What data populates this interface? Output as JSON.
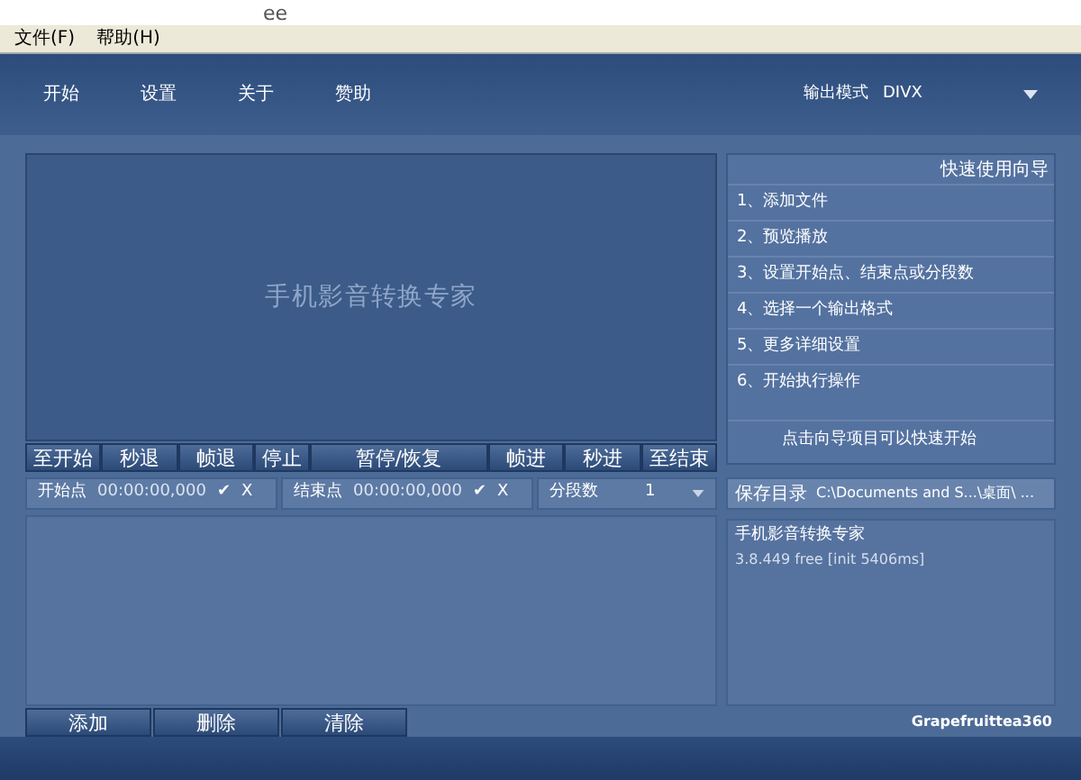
{
  "window": {
    "title": "ee"
  },
  "menu": [
    "文件(F)",
    "帮助(H)"
  ],
  "nav": [
    "开始",
    "设置",
    "关于",
    "赞助"
  ],
  "output_mode": {
    "label": "输出模式",
    "value": "DIVX"
  },
  "preview": {
    "title": "手机影音转换专家"
  },
  "playback_buttons": [
    "至开始",
    "秒退",
    "帧退",
    "停止",
    "暂停/恢复",
    "帧进",
    "秒进",
    "至结束"
  ],
  "start_point": {
    "label": "开始点",
    "value": "00:00:00,000",
    "confirm": "✔",
    "clear": "X"
  },
  "end_point": {
    "label": "结束点",
    "value": "00:00:00,000",
    "confirm": "✔",
    "clear": "X"
  },
  "segments": {
    "label": "分段数",
    "value": "1"
  },
  "file_buttons": [
    "添加",
    "删除",
    "清除"
  ],
  "credit": "Grapefruittea360",
  "wizard": {
    "title": "快速使用向导",
    "steps": [
      "1、添加文件",
      "2、预览播放",
      "3、设置开始点、结束点或分段数",
      "4、选择一个输出格式",
      "5、更多详细设置",
      "6、开始执行操作"
    ],
    "hint": "点击向导项目可以快速开始"
  },
  "save_dir": {
    "label": "保存目录",
    "value": "C:\\Documents and S...\\桌面\\ ..."
  },
  "info": {
    "name": "手机影音转换专家",
    "version": "3.8.449 free [init 5406ms]"
  }
}
